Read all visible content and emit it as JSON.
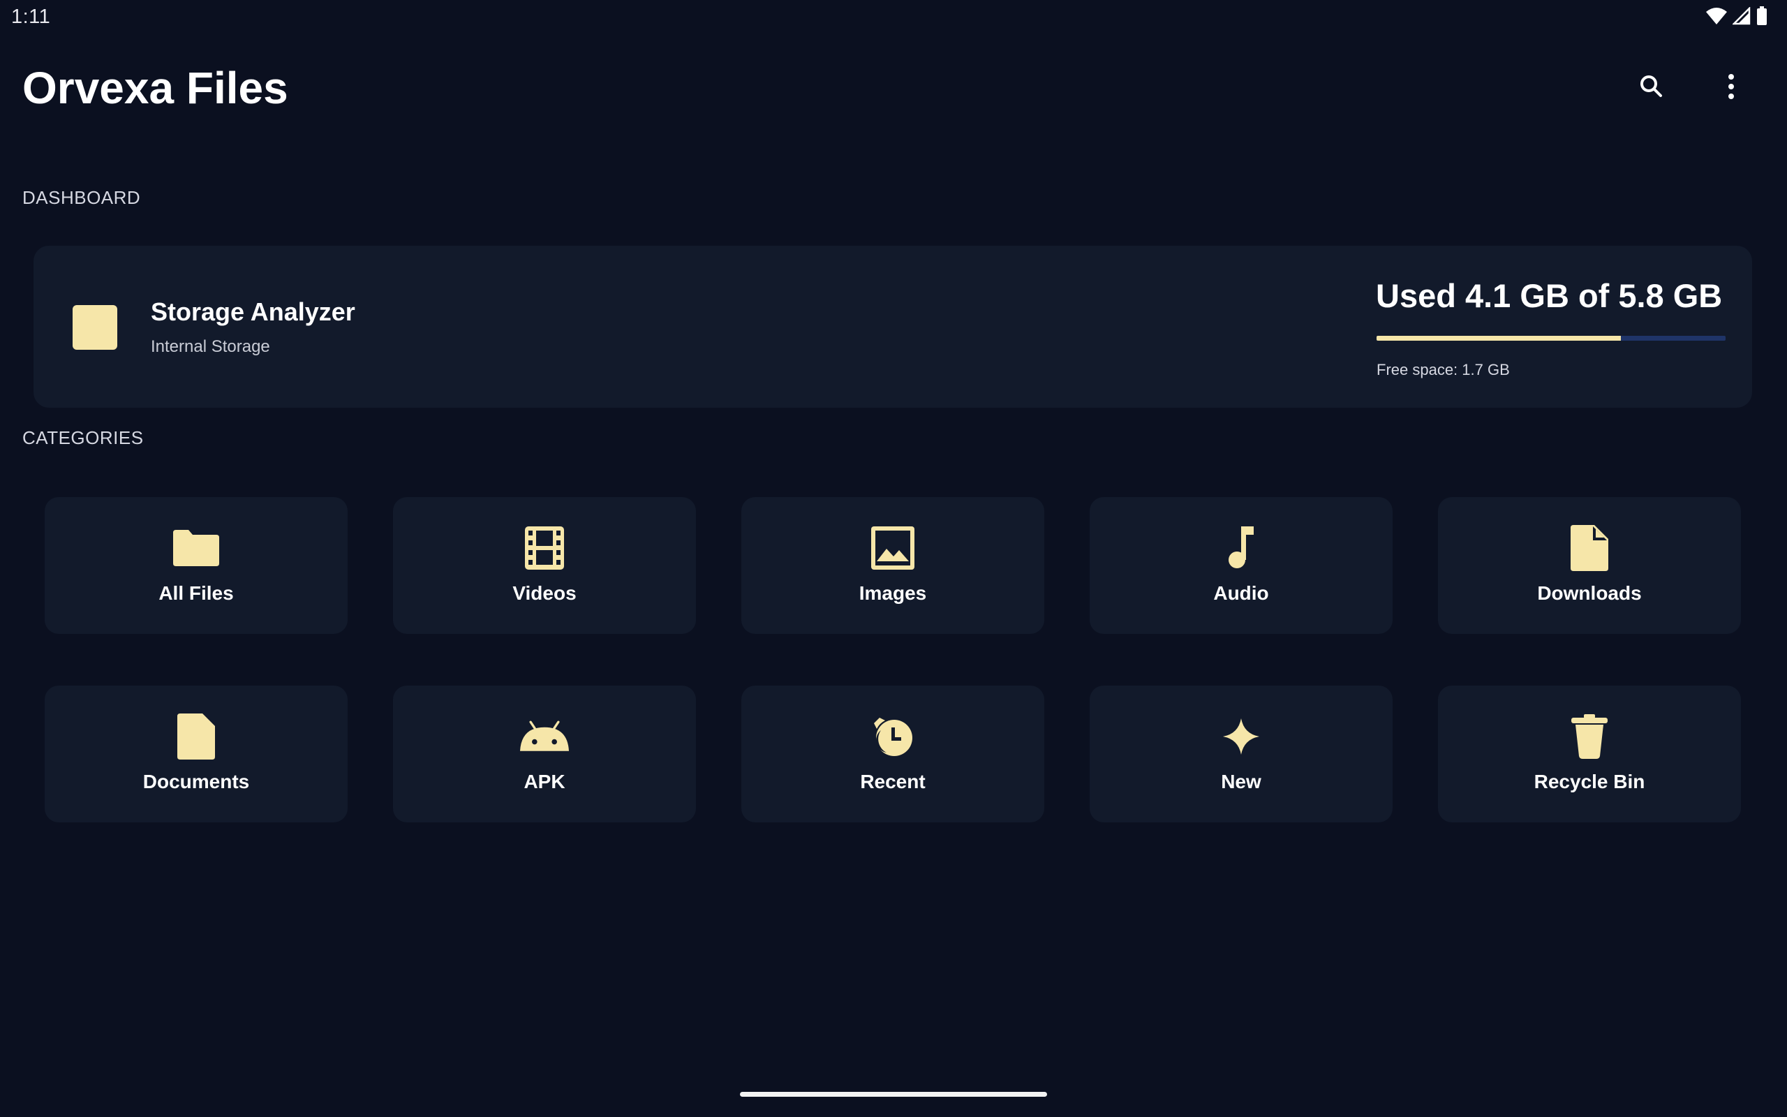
{
  "status_bar": {
    "time": "1:11",
    "icons": [
      "wifi-icon",
      "cell-signal-icon",
      "battery-icon"
    ]
  },
  "app_bar": {
    "title": "Orvexa Files",
    "actions": [
      "search-icon",
      "more-vert-icon"
    ]
  },
  "dashboard": {
    "section_label": "DASHBOARD",
    "storage": {
      "title": "Storage Analyzer",
      "subtitle": "Internal Storage",
      "used_text": "Used 4.1 GB of 5.8 GB",
      "used_fraction": 0.7,
      "free_text": "Free space: 1.7 GB"
    }
  },
  "categories": {
    "section_label": "CATEGORIES",
    "items": [
      {
        "label": "All Files",
        "icon": "folder-icon"
      },
      {
        "label": "Videos",
        "icon": "film-icon"
      },
      {
        "label": "Images",
        "icon": "image-icon"
      },
      {
        "label": "Audio",
        "icon": "music-note-icon"
      },
      {
        "label": "Downloads",
        "icon": "file-download-icon"
      },
      {
        "label": "Documents",
        "icon": "document-icon"
      },
      {
        "label": "APK",
        "icon": "android-icon"
      },
      {
        "label": "Recent",
        "icon": "history-icon"
      },
      {
        "label": "New",
        "icon": "sparkle-icon"
      },
      {
        "label": "Recycle Bin",
        "icon": "trash-icon"
      }
    ]
  },
  "colors": {
    "background": "#0b1020",
    "card": "#121a2b",
    "accent": "#f6e6a9",
    "progress_track": "#1f3468"
  }
}
